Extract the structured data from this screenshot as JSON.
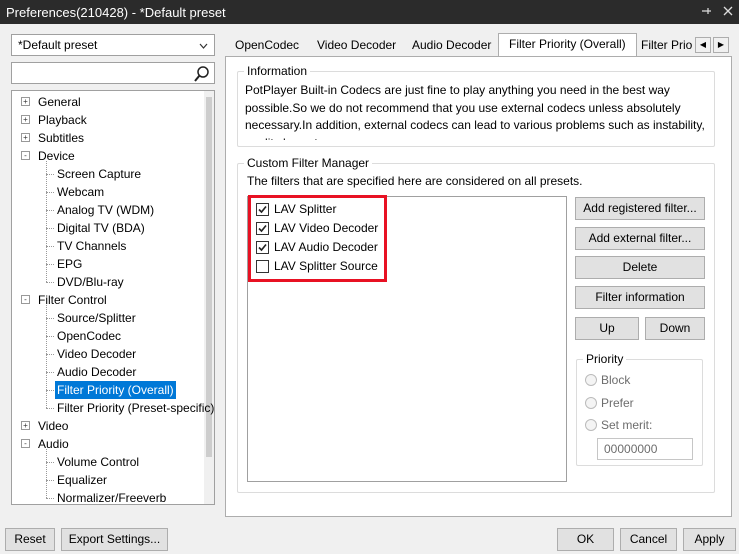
{
  "window": {
    "title": "Preferences(210428) - *Default preset"
  },
  "preset": {
    "selected": "*Default preset"
  },
  "search": {
    "value": ""
  },
  "tree": {
    "items": [
      {
        "label": "General",
        "indent": 0,
        "expander": "+"
      },
      {
        "label": "Playback",
        "indent": 0,
        "expander": "+"
      },
      {
        "label": "Subtitles",
        "indent": 0,
        "expander": "+"
      },
      {
        "label": "Device",
        "indent": 0,
        "expander": "-"
      },
      {
        "label": "Screen Capture",
        "indent": 1
      },
      {
        "label": "Webcam",
        "indent": 1
      },
      {
        "label": "Analog TV (WDM)",
        "indent": 1
      },
      {
        "label": "Digital TV (BDA)",
        "indent": 1
      },
      {
        "label": "TV Channels",
        "indent": 1
      },
      {
        "label": "EPG",
        "indent": 1
      },
      {
        "label": "DVD/Blu-ray",
        "indent": 1
      },
      {
        "label": "Filter Control",
        "indent": 0,
        "expander": "-"
      },
      {
        "label": "Source/Splitter",
        "indent": 1
      },
      {
        "label": "OpenCodec",
        "indent": 1
      },
      {
        "label": "Video Decoder",
        "indent": 1
      },
      {
        "label": "Audio Decoder",
        "indent": 1
      },
      {
        "label": "Filter Priority (Overall)",
        "indent": 1,
        "selected": true
      },
      {
        "label": "Filter Priority (Preset-specific)",
        "indent": 1
      },
      {
        "label": "Video",
        "indent": 0,
        "expander": "+"
      },
      {
        "label": "Audio",
        "indent": 0,
        "expander": "-"
      },
      {
        "label": "Volume Control",
        "indent": 1
      },
      {
        "label": "Equalizer",
        "indent": 1
      },
      {
        "label": "Normalizer/Freeverb",
        "indent": 1
      }
    ]
  },
  "tabs": [
    {
      "label": "OpenCodec"
    },
    {
      "label": "Video Decoder"
    },
    {
      "label": "Audio Decoder"
    },
    {
      "label": "Filter Priority (Overall)",
      "active": true
    },
    {
      "label": "Filter Prio"
    }
  ],
  "information": {
    "title": "Information",
    "text": "PotPlayer Built-in Codecs are just fine to play anything you need in the best way possible.So we do not recommend that you use external codecs unless absolutely necessary.In addition, external codecs can lead to various problems such as instability, quality loss etc."
  },
  "manager": {
    "title": "Custom Filter Manager",
    "description": "The filters that are specified here are considered on all presets.",
    "filters": [
      {
        "label": "LAV Splitter",
        "checked": true
      },
      {
        "label": "LAV Video Decoder",
        "checked": true
      },
      {
        "label": "LAV Audio Decoder",
        "checked": true
      },
      {
        "label": "LAV Splitter Source",
        "checked": false
      }
    ],
    "buttons": {
      "add_registered": "Add registered filter...",
      "add_external": "Add external filter...",
      "delete": "Delete",
      "filter_info": "Filter information",
      "up": "Up",
      "down": "Down"
    }
  },
  "priority": {
    "title": "Priority",
    "block": "Block",
    "prefer": "Prefer",
    "set_merit": "Set merit:",
    "merit_value": "00000000"
  },
  "footer": {
    "reset": "Reset",
    "export": "Export Settings...",
    "ok": "OK",
    "cancel": "Cancel",
    "apply": "Apply"
  },
  "colors": {
    "selection": "#0078d7",
    "highlight_box": "#e81123",
    "titlebar": "#2b2b2b"
  }
}
